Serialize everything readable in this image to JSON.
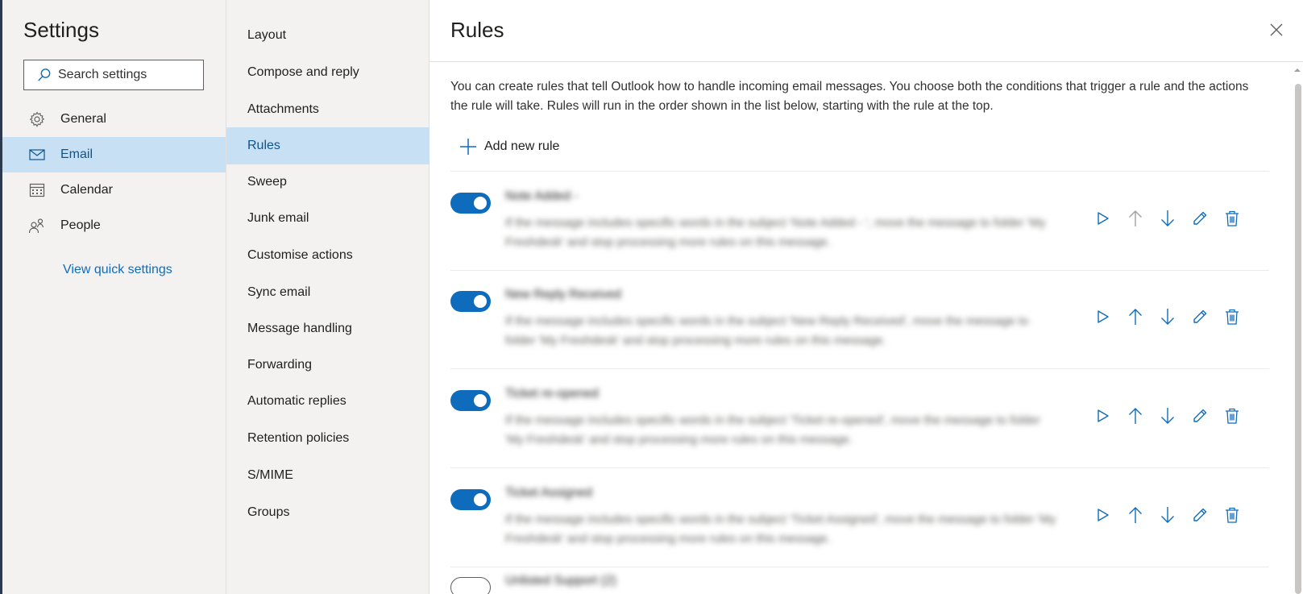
{
  "settings": {
    "title": "Settings",
    "search_placeholder": "Search settings",
    "nav": [
      {
        "label": "General",
        "icon": "gear-icon",
        "selected": false
      },
      {
        "label": "Email",
        "icon": "mail-icon",
        "selected": true
      },
      {
        "label": "Calendar",
        "icon": "calendar-icon",
        "selected": false
      },
      {
        "label": "People",
        "icon": "people-icon",
        "selected": false
      }
    ],
    "quick_settings_link": "View quick settings"
  },
  "email_nav": [
    {
      "label": "Layout"
    },
    {
      "label": "Compose and reply"
    },
    {
      "label": "Attachments"
    },
    {
      "label": "Rules",
      "selected": true
    },
    {
      "label": "Sweep"
    },
    {
      "label": "Junk email"
    },
    {
      "label": "Customise actions"
    },
    {
      "label": "Sync email"
    },
    {
      "label": "Message handling"
    },
    {
      "label": "Forwarding"
    },
    {
      "label": "Automatic replies"
    },
    {
      "label": "Retention policies"
    },
    {
      "label": "S/MIME"
    },
    {
      "label": "Groups"
    }
  ],
  "main": {
    "title": "Rules",
    "description": "You can create rules that tell Outlook how to handle incoming email messages. You choose both the conditions that trigger a rule and the actions the rule will take. Rules will run in the order shown in the list below, starting with the rule at the top.",
    "add_rule_label": "Add new rule",
    "rules": [
      {
        "name": "Note Added -",
        "description": "If the message includes specific words in the subject 'Note Added - ', move the message to folder 'My Freshdesk' and stop processing more rules on this message.",
        "enabled": true
      },
      {
        "name": "New Reply Received",
        "description": "If the message includes specific words in the subject 'New Reply Received', move the message to folder 'My Freshdesk' and stop processing more rules on this message.",
        "enabled": true
      },
      {
        "name": "Ticket re-opened",
        "description": "If the message includes specific words in the subject 'Ticket re-opened', move the message to folder 'My Freshdesk' and stop processing more rules on this message.",
        "enabled": true
      },
      {
        "name": "Ticket Assigned",
        "description": "If the message includes specific words in the subject 'Ticket Assigned', move the message to folder 'My Freshdesk' and stop processing more rules on this message.",
        "enabled": true
      },
      {
        "name": "Unlisted Support (2)",
        "description": "",
        "enabled": false
      }
    ]
  },
  "colors": {
    "accent": "#0f6cbd",
    "selected_bg": "#c7e0f4",
    "pane_bg": "#f3f2f1"
  }
}
